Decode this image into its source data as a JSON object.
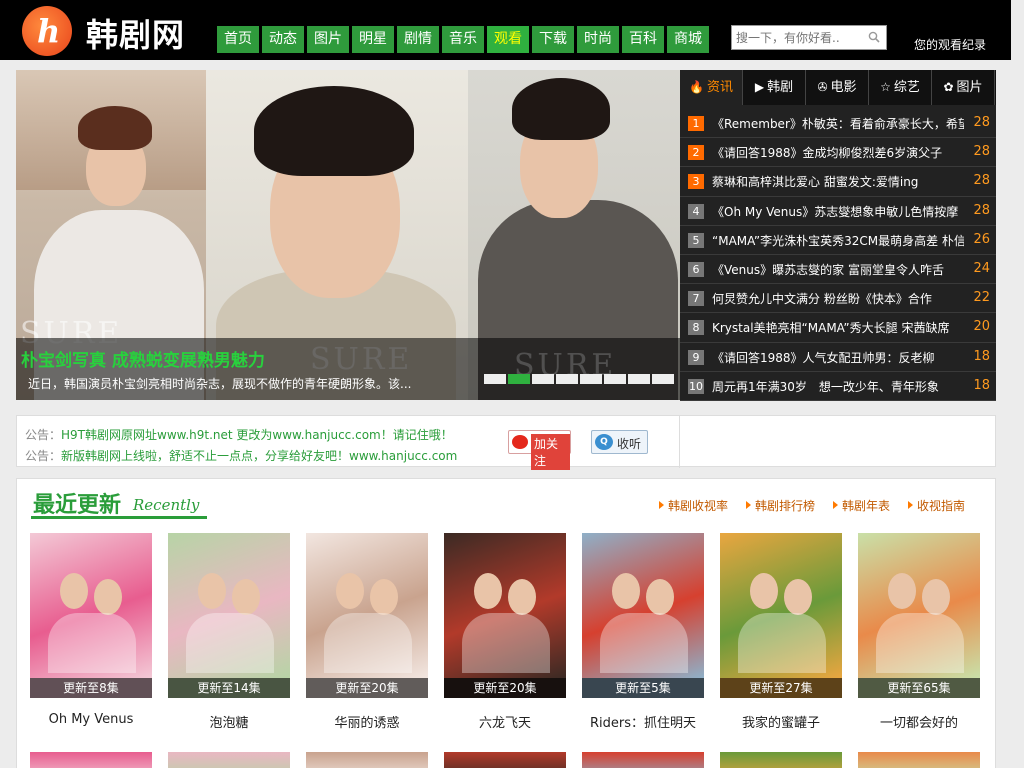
{
  "header": {
    "site_name": "韩剧网",
    "logo_letter": "h",
    "nav": [
      {
        "label": "首页",
        "active": false
      },
      {
        "label": "动态",
        "active": false
      },
      {
        "label": "图片",
        "active": false
      },
      {
        "label": "明星",
        "active": false
      },
      {
        "label": "剧情",
        "active": false
      },
      {
        "label": "音乐",
        "active": false
      },
      {
        "label": "观看",
        "active": true
      },
      {
        "label": "下载",
        "active": false
      },
      {
        "label": "时尚",
        "active": false
      },
      {
        "label": "百科",
        "active": false
      },
      {
        "label": "商城",
        "active": false
      }
    ],
    "search_placeholder": "搜一下，有你好看..",
    "history_link": "您的观看纪录"
  },
  "hero": {
    "watermark": "SURE",
    "title": "朴宝剑写真 成熟蜕变展熟男魅力",
    "description": "近日，韩国演员朴宝剑亮相时尚杂志，展现不做作的青年硬朗形象。该...",
    "slide_count": 8,
    "active_slide": 2
  },
  "ranking": {
    "tabs": [
      {
        "label": "资讯",
        "icon": "fire-icon",
        "glyph": "🔥",
        "active": true
      },
      {
        "label": "韩剧",
        "icon": "tv-icon",
        "glyph": "▶",
        "active": false
      },
      {
        "label": "电影",
        "icon": "film-reel-icon",
        "glyph": "✇",
        "active": false
      },
      {
        "label": "综艺",
        "icon": "star-icon",
        "glyph": "☆",
        "active": false
      },
      {
        "label": "图片",
        "icon": "mickey-icon",
        "glyph": "✿",
        "active": false
      }
    ],
    "items": [
      {
        "rank": "1",
        "title": "《Remember》朴敏英：看着俞承豪长大，希望",
        "count": "28"
      },
      {
        "rank": "2",
        "title": "《请回答1988》金成均柳俊烈差6岁演父子",
        "count": "28"
      },
      {
        "rank": "3",
        "title": "蔡琳和高梓淇比爱心 甜蜜发文:爱情ing",
        "count": "28"
      },
      {
        "rank": "4",
        "title": "《Oh My Venus》苏志燮想象申敏儿色情按摩",
        "count": "28"
      },
      {
        "rank": "5",
        "title": "“MAMA”李光洙朴宝英秀32CM最萌身高差 朴信",
        "count": "26"
      },
      {
        "rank": "6",
        "title": "《Venus》曝苏志燮的家 富丽堂皇令人咋舌",
        "count": "24"
      },
      {
        "rank": "7",
        "title": "何炅赞允儿中文满分 粉丝盼《快本》合作",
        "count": "22"
      },
      {
        "rank": "8",
        "title": "Krystal美艳亮相“MAMA”秀大长腿 宋茜缺席",
        "count": "20"
      },
      {
        "rank": "9",
        "title": "《请回答1988》人气女配丑帅男：反老柳",
        "count": "18"
      },
      {
        "rank": "10",
        "title": "周元再1年满30岁　想一改少年、青年形象",
        "count": "18"
      }
    ]
  },
  "notice": {
    "label": "公告：",
    "line1": "H9T韩剧网原网址www.h9t.net 更改为www.hanjucc.com！请记住哦！",
    "line2": "新版韩剧网上线啦，舒适不止一点点，分享给好友吧！www.hanjucc.com",
    "follow_label": "加关注",
    "listen_label": "收听",
    "listen_icon_text": "Q"
  },
  "recent": {
    "title": "最近更新",
    "subtitle": "Recently",
    "links": [
      "韩剧收视率",
      "韩剧排行榜",
      "韩剧年表",
      "收视指南"
    ],
    "posters": [
      {
        "title": "Oh My Venus",
        "badge": "更新至8集",
        "bg": "#f3c9d6",
        "accent": "#e85d8f"
      },
      {
        "title": "泡泡糖",
        "badge": "更新至14集",
        "bg": "#b7d4a6",
        "accent": "#e9b7c2"
      },
      {
        "title": "华丽的诱惑",
        "badge": "更新至20集",
        "bg": "#f2e6e0",
        "accent": "#c9a38e"
      },
      {
        "title": "六龙飞天",
        "badge": "更新至20集",
        "bg": "#3b2a24",
        "accent": "#b23a2a"
      },
      {
        "title": "Riders：抓住明天",
        "badge": "更新至5集",
        "bg": "#8fb0c8",
        "accent": "#d6402f"
      },
      {
        "title": "我家的蜜罐子",
        "badge": "更新至27集",
        "bg": "#e9a640",
        "accent": "#6a9a3a"
      },
      {
        "title": "一切都会好的",
        "badge": "更新至65集",
        "bg": "#c9e0a8",
        "accent": "#e98a4a"
      }
    ]
  }
}
